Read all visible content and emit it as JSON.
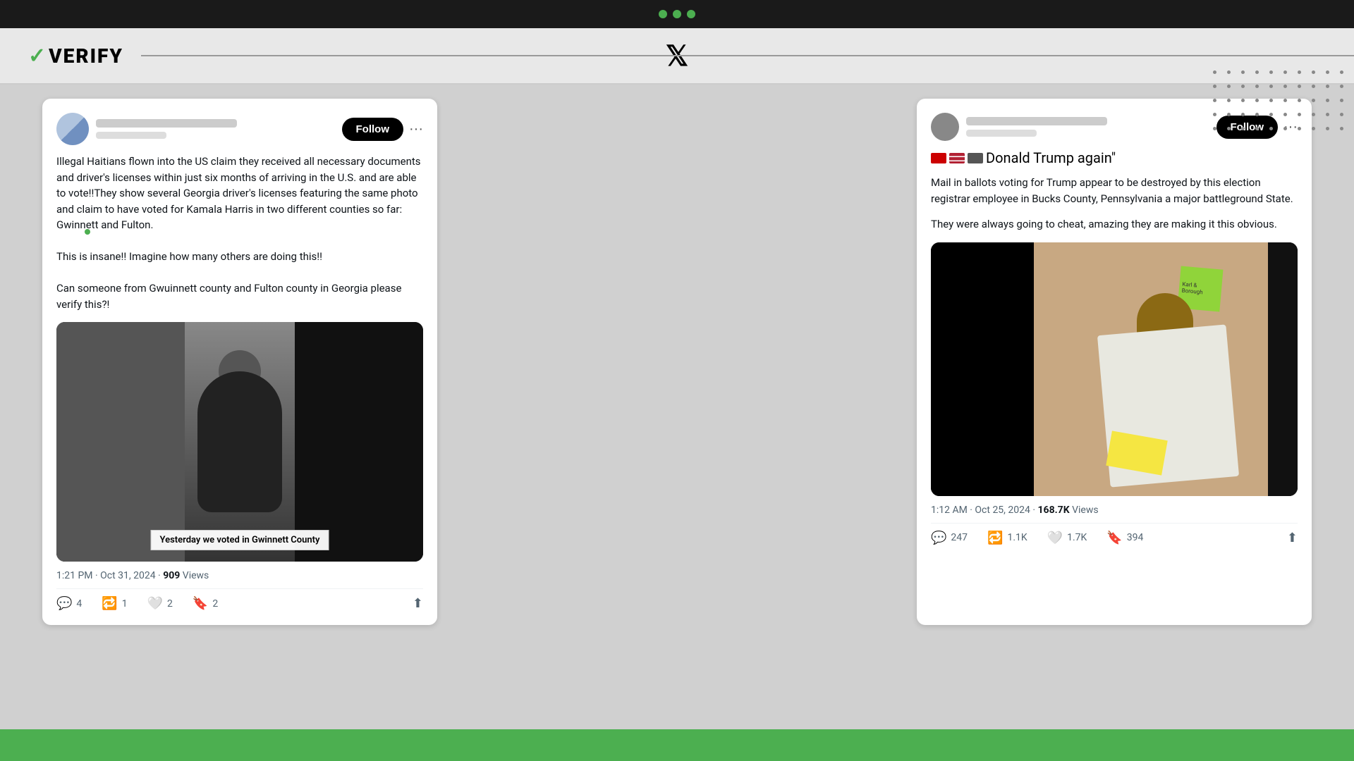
{
  "app": {
    "title": "VERIFY",
    "top_bar_dots": [
      "green",
      "green",
      "green"
    ]
  },
  "header": {
    "logo_check": "✓",
    "logo_text": "VERIFY",
    "x_logo": "𝕏"
  },
  "tweet1": {
    "follow_label": "Follow",
    "more_label": "···",
    "body": "Illegal Haitians flown into the US claim they received all necessary documents and driver's licenses within just six months of arriving in the U.S. and are able to vote!!They show several Georgia driver's licenses featuring the same photo and claim to have voted for Kamala Harris in two different counties so far: Gwinnett and Fulton.\n\nThis is insane!! Imagine how many others are doing this!!\n\nCan someone from Gwuinnett county and Fulton county in Georgia please verify this?!",
    "caption": "Yesterday we voted in\nGwinnett County",
    "meta_time": "1:21 PM · Oct 31, 2024 ·",
    "views_count": "909",
    "views_label": "Views",
    "actions": {
      "replies": "4",
      "retweets": "1",
      "likes": "2",
      "bookmarks": "2"
    }
  },
  "tweet2": {
    "follow_label": "Follow",
    "more_label": "···",
    "flag_text": "Donald Trump again\"",
    "body1": "Mail in ballots voting for Trump appear to be destroyed by this election registrar employee in Bucks County, Pennsylvania a major battleground State.",
    "body2": "They were always going to cheat, amazing they are making it this obvious.",
    "meta_time": "1:12 AM · Oct 25, 2024 ·",
    "views_count": "168.7K",
    "views_label": "Views",
    "actions": {
      "replies": "247",
      "retweets": "1.1K",
      "likes": "1.7K",
      "bookmarks": "394"
    }
  }
}
